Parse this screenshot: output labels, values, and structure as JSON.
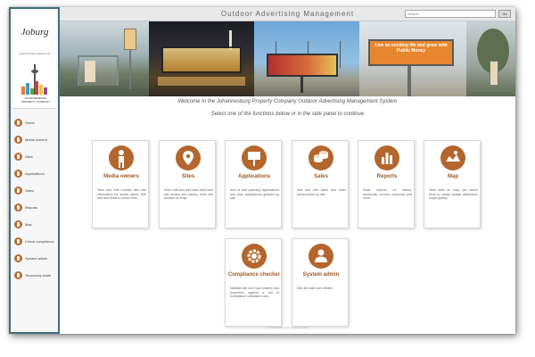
{
  "header": {
    "app_title": "Outdoor Advertising Management",
    "search_placeholder": "Search",
    "go_label": "Go"
  },
  "sidebar": {
    "logo_text": "Joburg",
    "logo_tagline": "a world class african city",
    "jpc_text": "JOHANNESBURG PROPERTY COMPANY",
    "items": [
      {
        "label": "Home"
      },
      {
        "label": "Media owners"
      },
      {
        "label": "Sites"
      },
      {
        "label": "Applications"
      },
      {
        "label": "Sales"
      },
      {
        "label": "Reports"
      },
      {
        "label": "Map"
      },
      {
        "label": "Check compliance"
      },
      {
        "label": "System admin"
      },
      {
        "label": "Temporary Adds"
      }
    ]
  },
  "banner": {
    "billboard_text": "Live an exciting life and grow with Public Money"
  },
  "main": {
    "welcome": "Welcome to the Johannesburg Property Company Outdoor Advertising Management System",
    "instructions": "Select one of the functions below or in the side panel to continue",
    "cards": [
      {
        "title": "Media owners",
        "icon": "person-icon",
        "desc": "View and edit contact and site information for media owner. Edit and add fields to owner files."
      },
      {
        "title": "Sites",
        "icon": "map-pin-icon",
        "desc": "View, edit and print sites that have site details and history. View site location on map."
      },
      {
        "title": "Applications",
        "icon": "signboard-icon",
        "desc": "Add or edit planning applications and view applications granted by site."
      },
      {
        "title": "Sales",
        "icon": "coins-icon",
        "desc": "Add and edit sales and enter actual prices by site."
      },
      {
        "title": "Reports",
        "icon": "bar-chart-icon",
        "desc": "Draw reports on status, ownership, income, expenses and more."
      },
      {
        "title": "Map",
        "icon": "map-icon",
        "desc": "View sites on map: you select them to create spatial distribution maps quickly."
      },
      {
        "title": "Compliance checker",
        "icon": "gear-icon",
        "desc": "Validate site and map location and properties against a set of compliance validation rules."
      },
      {
        "title": "System admin",
        "icon": "user-admin-icon",
        "desc": "Edit and add user details."
      }
    ],
    "footer": "© Johannesburg Property Company"
  },
  "colors": {
    "accent": "#b4662c",
    "sidebar_border": "#3f6f7c"
  }
}
